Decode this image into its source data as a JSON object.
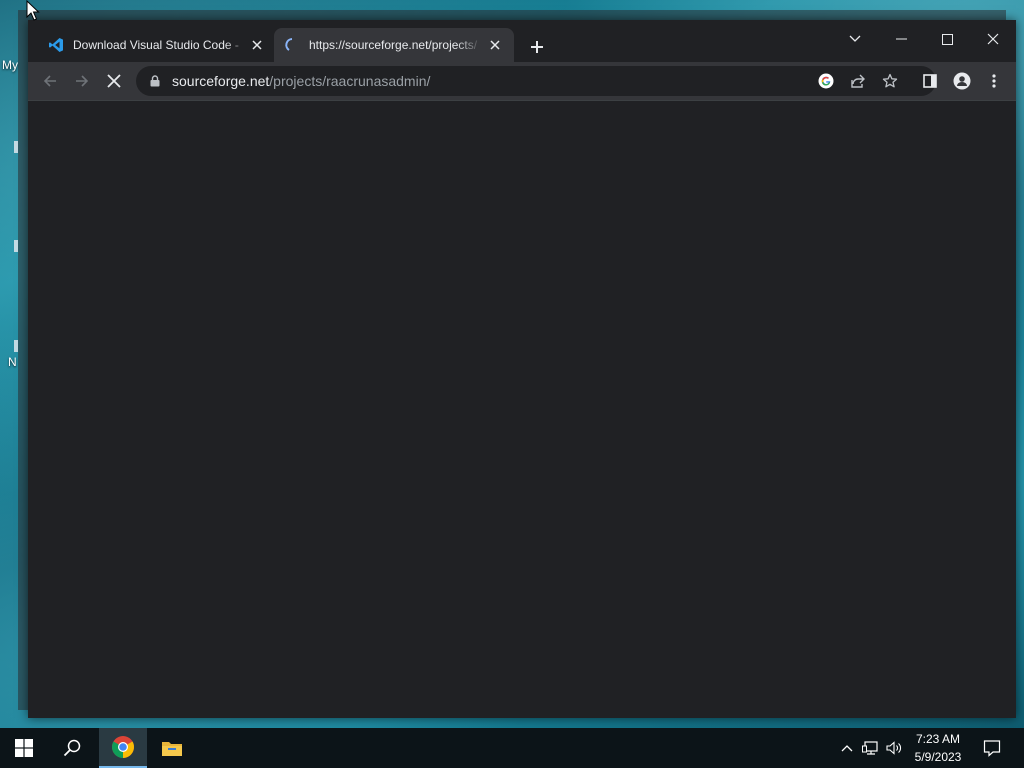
{
  "desktop": {
    "icon_label_1": "My",
    "icon_label_2": "N"
  },
  "browser": {
    "tabs": [
      {
        "title": "Download Visual Studio Code - M",
        "favicon": "vscode-icon",
        "active": false
      },
      {
        "title": "https://sourceforge.net/projects/",
        "favicon": "loading-spinner-icon",
        "active": true
      }
    ],
    "address": {
      "host": "sourceforge.net",
      "path": "/projects/raacrunasadmin/"
    },
    "colors": {
      "frame": "#202124",
      "toolbar": "#35363a",
      "text": "#e8eaed",
      "muted": "#9aa0a6"
    }
  },
  "taskbar": {
    "clock_time": "7:23 AM",
    "clock_date": "5/9/2023",
    "pinned": [
      "windows-start-icon",
      "search-icon",
      "chrome-icon",
      "file-explorer-icon"
    ],
    "tray": [
      "chevron-up-icon",
      "network-icon",
      "volume-icon",
      "notifications-icon"
    ]
  }
}
